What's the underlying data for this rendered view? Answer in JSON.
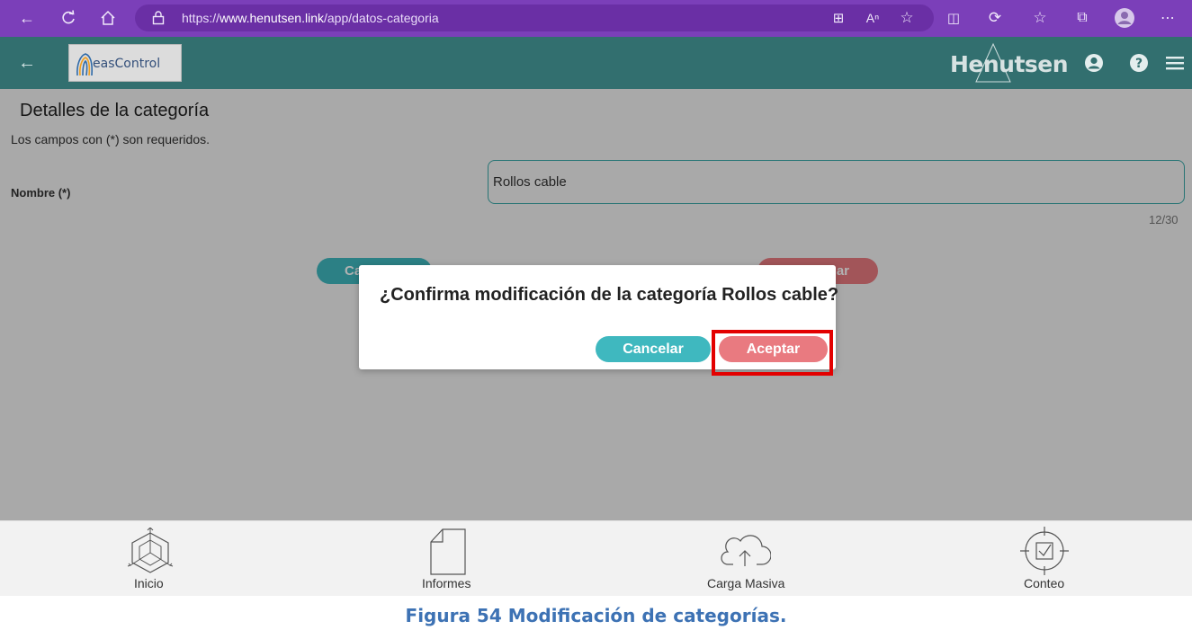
{
  "browser": {
    "url_prefix": "https://",
    "url_domain": "www.henutsen.link",
    "url_path": "/app/datos-categoria"
  },
  "app": {
    "logo_text": "easControl",
    "brand": "Henutsen"
  },
  "page": {
    "title": "Detalles de la categoría",
    "required_note": "Los campos con (*) son requeridos.",
    "name_label": "Nombre (*)",
    "name_value": "Rollos cable",
    "char_counter": "12/30",
    "cancel_label_partial": "Ca",
    "save_label_partial": "ar"
  },
  "modal": {
    "message": "¿Confirma modificación de la categoría Rollos cable?",
    "cancel_label": "Cancelar",
    "accept_label": "Aceptar"
  },
  "bottom_nav": [
    {
      "label": "Inicio",
      "icon": "cube-icon"
    },
    {
      "label": "Informes",
      "icon": "document-icon"
    },
    {
      "label": "Carga Masiva",
      "icon": "cloud-upload-icon"
    },
    {
      "label": "Conteo",
      "icon": "target-check-icon"
    }
  ],
  "caption": "Figura 54 Modificación de categorías.",
  "colors": {
    "browser": "#7b3fb9",
    "header": "#326f6f",
    "teal": "#3fb8bf",
    "salmon": "#e97a80",
    "highlight": "#e30000",
    "caption": "#3d72b4"
  }
}
